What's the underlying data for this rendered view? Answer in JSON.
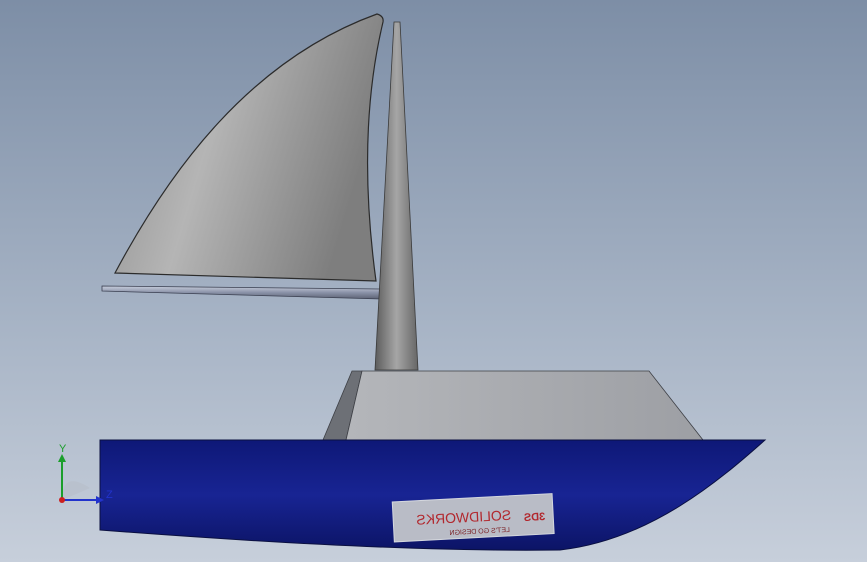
{
  "window": {
    "background_top": "#7d8ea6",
    "background_bottom": "#c7cfdb"
  },
  "model": {
    "name": "sailboat",
    "parts": [
      "sail",
      "boom",
      "mast",
      "cabin",
      "hull",
      "logo-decal"
    ],
    "colors": {
      "hull": "#101a7a",
      "sail": "#9a9a9a",
      "mast": "#7a7a7a",
      "cabin": "#a9abb0",
      "boom": "#8f96aa"
    }
  },
  "decal": {
    "brand": "SOLIDWORKS",
    "tagline": "LET'S GO DESIGN",
    "logo_text": "3DS",
    "mirrored": true,
    "color": "#b2282e"
  },
  "triad": {
    "y_label": "Y",
    "z_label": "Z",
    "colors": {
      "y": "#1b9e2b",
      "z": "#2233cc",
      "x": "#cc1f1f"
    }
  }
}
